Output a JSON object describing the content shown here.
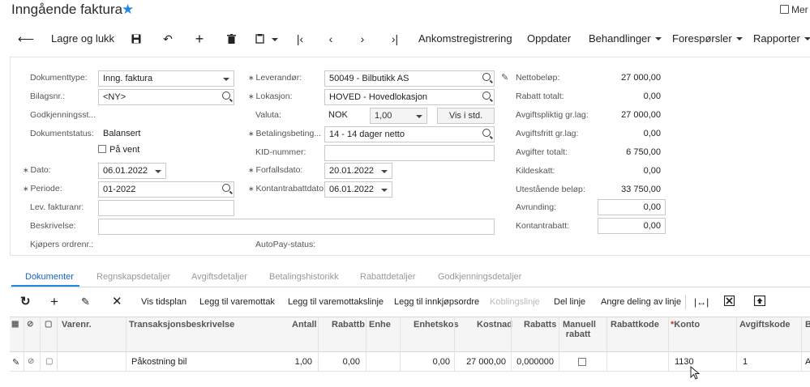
{
  "header": {
    "title": "Inngående faktura",
    "more_label": "Mer"
  },
  "toolbar": {
    "save_close": "Lagre og lukk",
    "ankomst": "Ankomstregistrering",
    "oppdater": "Oppdater",
    "behandlinger": "Behandlinger",
    "foresporsler": "Forespørsler",
    "rapporter": "Rapporter"
  },
  "form": {
    "dokumenttype_label": "Dokumenttype:",
    "dokumenttype_value": "Inng. faktura",
    "bilagsnr_label": "Bilagsnr.:",
    "bilagsnr_value": "<NY>",
    "godkjenning_label": "Godkjenningsst...",
    "dokumentstatus_label": "Dokumentstatus:",
    "dokumentstatus_value": "Balansert",
    "paa_vent_label": "På vent",
    "dato_label": "Dato:",
    "dato_value": "06.01.2022",
    "periode_label": "Periode:",
    "periode_value": "01-2022",
    "lev_fakturanr_label": "Lev. fakturanr:",
    "beskrivelse_label": "Beskrivelse:",
    "kjopers_ordrenr_label": "Kjøpers ordrenr.:",
    "leverandor_label": "Leverandør:",
    "leverandor_value": "50049 - Bilbutikk AS",
    "lokasjon_label": "Lokasjon:",
    "lokasjon_value": "HOVED - Hovedlokasjon",
    "valuta_label": "Valuta:",
    "valuta_value": "NOK",
    "kurs_value": "1,00",
    "vis_i_std": "Vis i std.",
    "betalingsbet_label": "Betalingsbeting...",
    "betalingsbet_value": "14 - 14 dager netto",
    "kid_label": "KID-nummer:",
    "forfallsdato_label": "Forfallsdato:",
    "forfallsdato_value": "20.01.2022",
    "kontantrabattdato_label": "Kontantrabattdato:",
    "kontantrabattdato_value": "06.01.2022",
    "autopay_label": "AutoPay-status:"
  },
  "summary": {
    "netto_label": "Nettobeløp:",
    "netto_value": "27 000,00",
    "rabatt_label": "Rabatt totalt:",
    "rabatt_value": "0,00",
    "avgpl_label": "Avgiftspliktig gr.lag:",
    "avgpl_value": "27 000,00",
    "avgfri_label": "Avgiftsfritt gr.lag:",
    "avgfri_value": "0,00",
    "avgtot_label": "Avgifter totalt:",
    "avgtot_value": "6 750,00",
    "kildeskatt_label": "Kildeskatt:",
    "kildeskatt_value": "0,00",
    "utestaende_label": "Utestående beløp:",
    "utestaende_value": "33 750,00",
    "avrunding_label": "Avrunding:",
    "avrunding_value": "0,00",
    "kontantrabatt_label": "Kontantrabatt:",
    "kontantrabatt_value": "0,00"
  },
  "tabs": [
    "Dokumenter",
    "Regnskapsdetaljer",
    "Avgiftsdetaljer",
    "Betalingshistorikk",
    "Rabattdetaljer",
    "Godkjenningsdetaljer"
  ],
  "grid_toolbar": {
    "vis_tidsplan": "Vis tidsplan",
    "legg_varemottak": "Legg til varemottak",
    "legg_varemottakslinje": "Legg til varemottakslinje",
    "legg_innkjopsordre": "Legg til innkjøpsordre",
    "koblingslinje": "Koblingslinje",
    "del_linje": "Del linje",
    "angre_deling": "Angre deling av linje"
  },
  "grid": {
    "headers": [
      "Varenr.",
      "Transaksjonsbeskrivelse",
      "Antall",
      "Rabattb",
      "Enhe",
      "Enhetskos",
      "Kostnad",
      "Rabatts",
      "Manuell",
      "rabatt",
      "Rabattkode",
      "Konto",
      "Avgiftskode",
      "B"
    ],
    "row": {
      "beskrivelse": "Påkostning bil",
      "antall": "1,00",
      "rabattb": "0,00",
      "enhetskost": "0,00",
      "kostnad": "27 000,00",
      "rabatts": "0,000000",
      "konto": "1130",
      "avgiftskode": "1",
      "b": "A"
    }
  },
  "colors": {
    "accent": "#1e88e5",
    "tab_active": "#1565c0"
  },
  "icons": [
    "star-icon",
    "back-arrow-icon",
    "save-icon",
    "undo-icon",
    "plus-icon",
    "trash-icon",
    "copy-paste-icon",
    "first-page-icon",
    "prev-page-icon",
    "next-page-icon",
    "last-page-icon",
    "refresh-icon",
    "pencil-icon",
    "close-icon",
    "fit-columns-icon",
    "excel-icon",
    "upload-icon",
    "search-icon",
    "chevron-down-icon"
  ]
}
